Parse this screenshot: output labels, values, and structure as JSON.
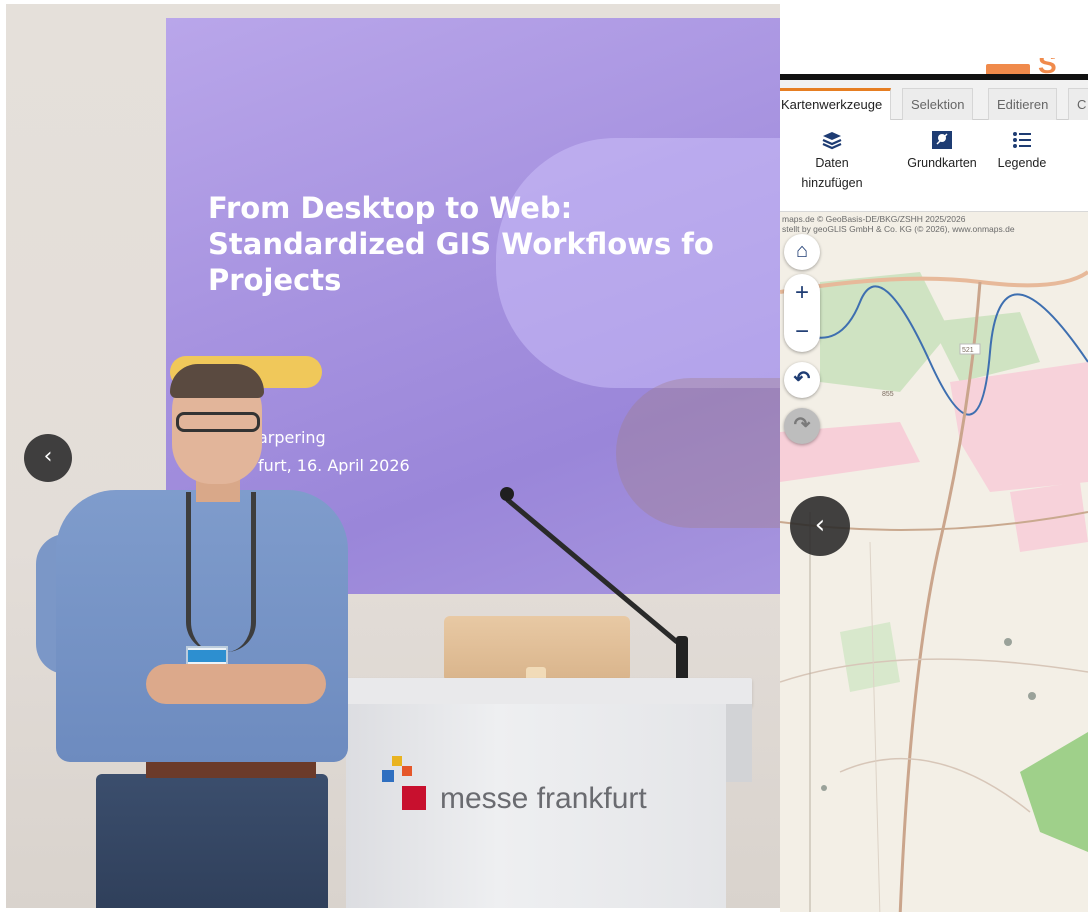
{
  "photo": {
    "slide": {
      "title_lines": [
        "From Desktop to Web:",
        "Standardized GIS Workflows fo",
        "Projects"
      ],
      "presenter": "arpering",
      "place_date": "furt, 16. April 2026"
    },
    "podium_brand": "messe frankfurt",
    "prev_arrow": "‹"
  },
  "gis": {
    "tabs": [
      {
        "label": "Kartenwerkzeuge",
        "active": true
      },
      {
        "label": "Selektion",
        "active": false
      },
      {
        "label": "Editieren",
        "active": false
      },
      {
        "label": "C",
        "active": false
      }
    ],
    "ribbon": {
      "add_data_line1": "Daten",
      "add_data_line2": "hinzufügen",
      "basemaps": "Grundkarten",
      "legend": "Legende"
    },
    "map": {
      "credit_line1": "maps.de © GeoBasis-DE/BKG/ZSHH 2025/2026",
      "credit_line2": "stellt by geoGLIS GmbH & Co. KG (© 2026), www.onmaps.de",
      "home_icon": "⌂",
      "zoom_in": "+",
      "zoom_out": "−",
      "undo_icon": "↶",
      "redo_icon": "↷",
      "road_label": "521",
      "elevation_label": "855"
    },
    "prev_arrow": "‹"
  },
  "colors": {
    "tab_accent": "#e67e22",
    "map_button_icon": "#1e3c73",
    "slide_background": "#a793e0",
    "slide_accent": "#f0c85a",
    "brand_logo_orange": "#f08a4b"
  }
}
